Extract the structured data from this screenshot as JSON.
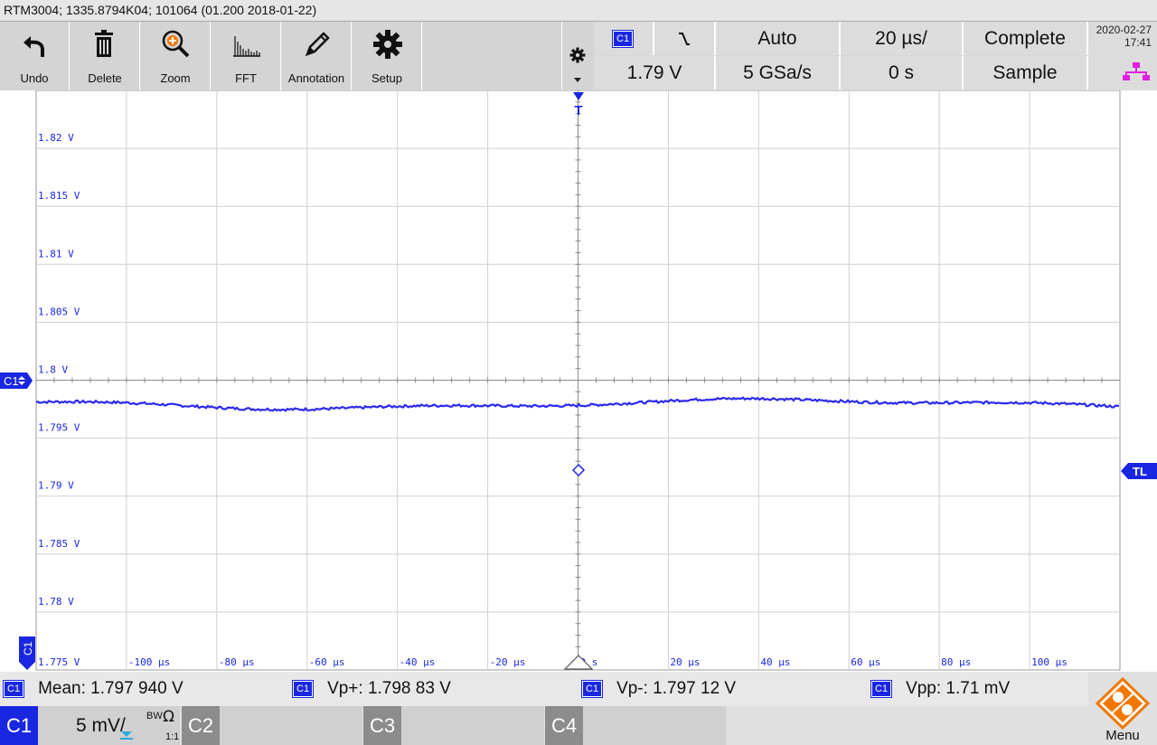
{
  "window": {
    "title": "RTM3004; 1335.8794K04; 101064 (01.200 2018-01-22)"
  },
  "toolbar": {
    "undo": "Undo",
    "delete": "Delete",
    "zoom": "Zoom",
    "fft": "FFT",
    "annotation": "Annotation",
    "setup": "Setup"
  },
  "trigger": {
    "channel": "C1",
    "mode": "Auto",
    "level": "1.79 V",
    "timebase": "20 µs/",
    "sample_rate": "5 GSa/s",
    "position": "0 s",
    "acquisition": "Complete",
    "acq_mode": "Sample"
  },
  "datetime": {
    "date": "2020-02-27",
    "time": "17:41"
  },
  "plot": {
    "y_labels": [
      "1.82 V",
      "1.815 V",
      "1.81 V",
      "1.805 V",
      "1.8 V",
      "1.795 V",
      "1.79 V",
      "1.785 V",
      "1.78 V",
      "1.775 V"
    ],
    "x_labels": [
      "-100 µs",
      "-80 µs",
      "-60 µs",
      "-40 µs",
      "-20 µs",
      "0 s",
      "20 µs",
      "40 µs",
      "60 µs",
      "80 µs",
      "100 µs"
    ],
    "channel_marker": "C1",
    "trigger_marker": "T",
    "trigger_level_marker": "TL",
    "bottom_channel_tag": "C1",
    "trace_color": "#2a2af0"
  },
  "measurements": {
    "channel": "C1",
    "mean": "Mean: 1.797 940 V",
    "vp_plus": "Vp+: 1.798 83 V",
    "vp_minus": "Vp-: 1.797 12 V",
    "vpp": "Vpp: 1.71 mV"
  },
  "channels": {
    "c1": "C1",
    "c1_scale": "5 mV/",
    "c1_bw": "BW",
    "c1_ohm": "Ω",
    "c1_ratio": "1:1",
    "c2": "C2",
    "c3": "C3",
    "c4": "C4",
    "menu": "Menu"
  }
}
